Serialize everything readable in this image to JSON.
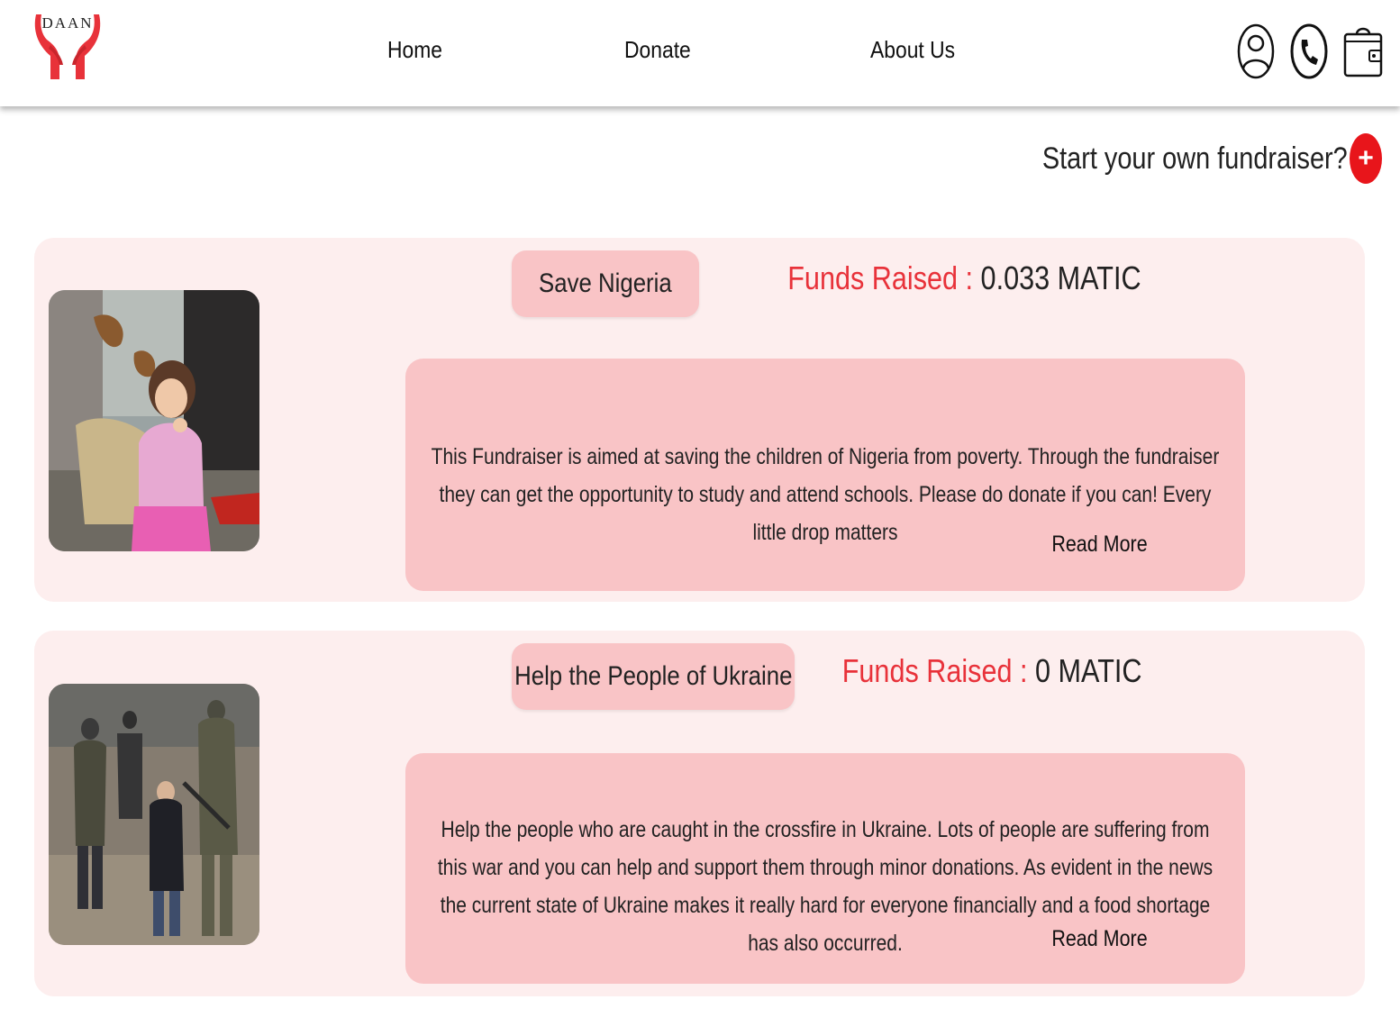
{
  "brand": {
    "logo_text": "DAAN",
    "accent": "#e8151b",
    "hands_color": "#e8323a"
  },
  "nav": {
    "links": [
      "Home",
      "Donate",
      "About Us"
    ],
    "icons": [
      "user-icon",
      "phone-icon",
      "wallet-icon"
    ]
  },
  "start_fundraiser": {
    "label": "Start your own fundraiser?",
    "button_symbol": "+"
  },
  "fundraisers": [
    {
      "title": "Save Nigeria",
      "funds_label": "Funds Raised :",
      "funds_value": "0.033 MATIC",
      "description": "This Fundraiser is aimed at saving the children of Nigeria from poverty. Through the fundraiser they can get the opportunity to study and attend schools. Please do donate if you can! Every little drop matters",
      "read_more": "Read More"
    },
    {
      "title": "Help the People of Ukraine",
      "funds_label": "Funds Raised :",
      "funds_value": "0 MATIC",
      "description": "Help the people who are caught in the crossfire in Ukraine. Lots of people are suffering from this war and you can help and support them through minor donations. As evident in the news the current state of Ukraine makes it really hard for everyone financially and a food shortage has also occurred.",
      "read_more": "Read More"
    }
  ],
  "colors": {
    "card_bg": "#fdeeee",
    "pill_bg": "#f9c4c6",
    "funds_label": "#e8323a"
  }
}
